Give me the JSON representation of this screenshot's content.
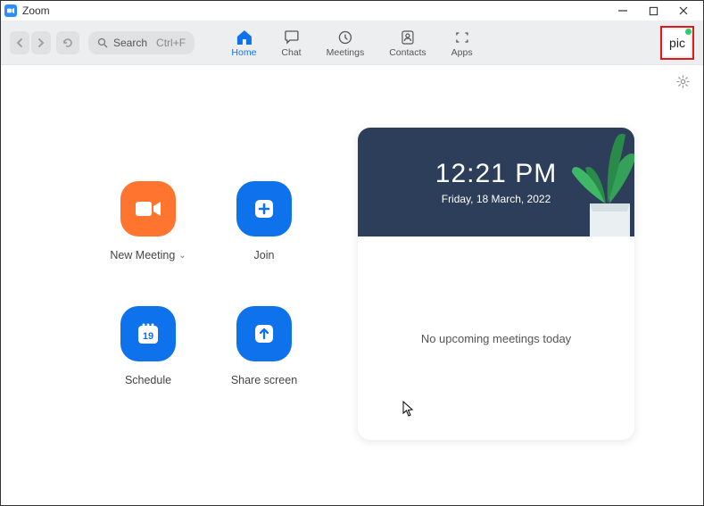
{
  "titlebar": {
    "title": "Zoom"
  },
  "toolbar": {
    "search_label": "Search",
    "search_shortcut": "Ctrl+F",
    "tabs": [
      {
        "label": "Home"
      },
      {
        "label": "Chat"
      },
      {
        "label": "Meetings"
      },
      {
        "label": "Contacts"
      },
      {
        "label": "Apps"
      }
    ],
    "profile_text": "pic"
  },
  "actions": {
    "new_meeting": "New Meeting",
    "join": "Join",
    "schedule": "Schedule",
    "schedule_day": "19",
    "share_screen": "Share screen"
  },
  "clock": {
    "time": "12:21 PM",
    "date": "Friday, 18 March, 2022"
  },
  "meetings": {
    "empty_message": "No upcoming meetings today"
  }
}
